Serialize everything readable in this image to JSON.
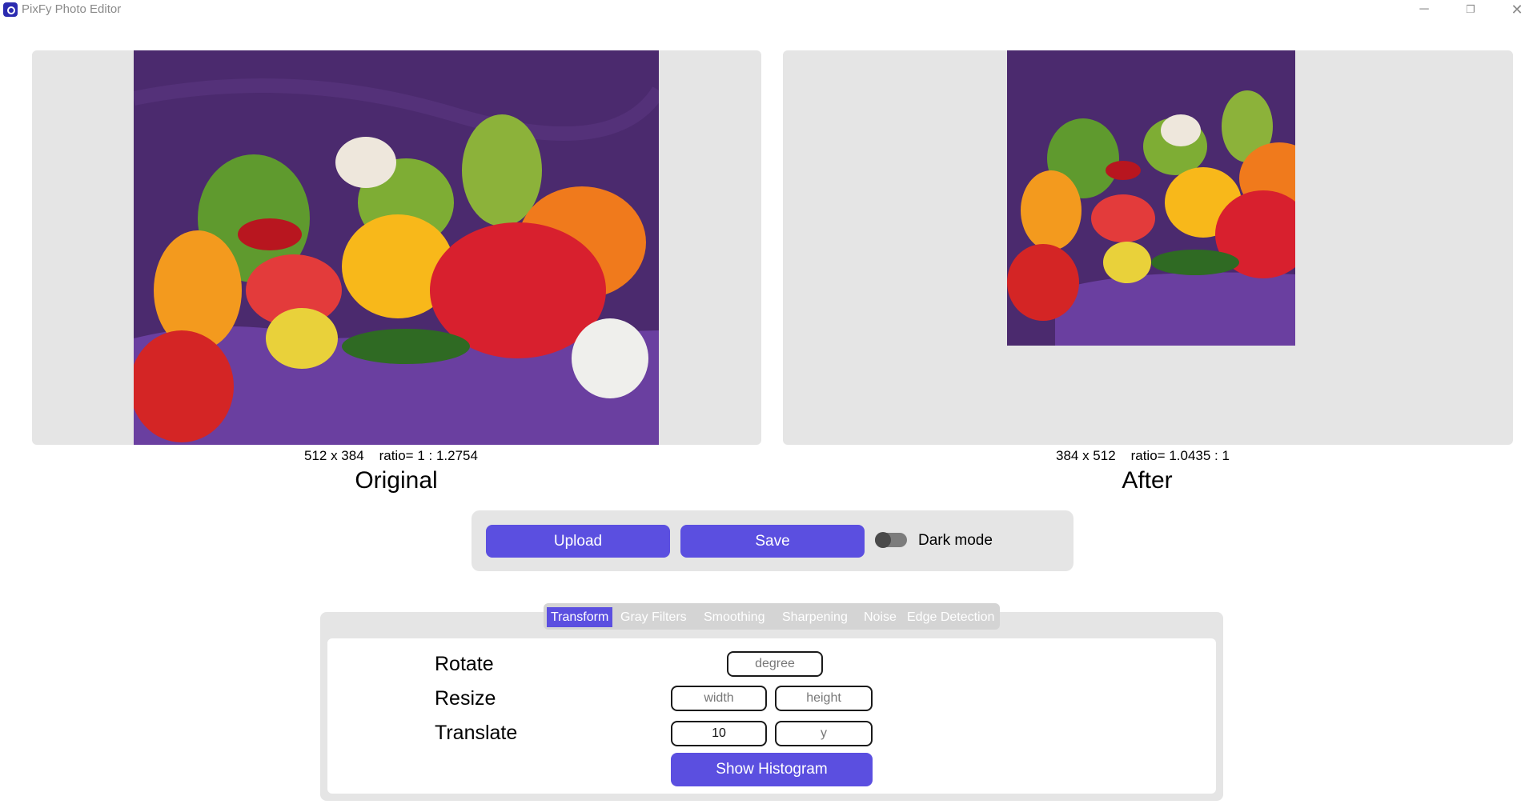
{
  "window": {
    "title": "PixFy Photo Editor",
    "minimize": "─",
    "maximize": "❐",
    "close": "✕"
  },
  "original": {
    "dimensions": "512 x 384",
    "ratio": "ratio= 1 : 1.2754",
    "caption": "Original"
  },
  "after": {
    "dimensions": "384 x 512",
    "ratio": "ratio= 1.0435 : 1",
    "caption": "After"
  },
  "actions": {
    "upload_label": "Upload",
    "save_label": "Save",
    "dark_mode_label": "Dark mode",
    "dark_mode_on": false
  },
  "tabs": [
    {
      "label": "Transform",
      "active": true
    },
    {
      "label": "Gray Filters",
      "active": false
    },
    {
      "label": "Smoothing",
      "active": false
    },
    {
      "label": "Sharpening",
      "active": false
    },
    {
      "label": "Noise",
      "active": false
    },
    {
      "label": "Edge Detection",
      "active": false
    }
  ],
  "transform": {
    "rotate_label": "Rotate",
    "rotate_placeholder": "degree",
    "resize_label": "Resize",
    "width_placeholder": "width",
    "height_placeholder": "height",
    "translate_label": "Translate",
    "translate_x_value": "10",
    "translate_y_placeholder": "y",
    "histogram_label": "Show Histogram"
  },
  "colors": {
    "accent": "#5b4fe0",
    "panel_bg": "#e5e5e5",
    "cloth_purple": "#4b2a6e"
  }
}
